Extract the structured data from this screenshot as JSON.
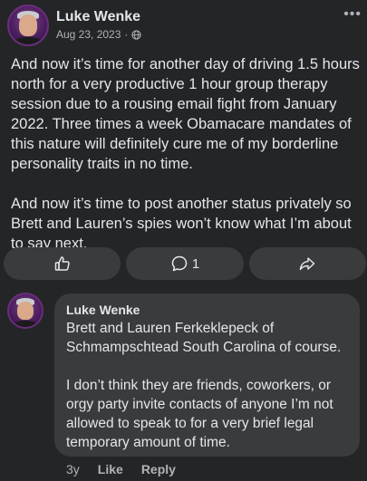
{
  "post": {
    "author": "Luke Wenke",
    "date": "Aug 23, 2023",
    "separator": "·",
    "privacy_icon": "globe-icon",
    "more_label": "•••",
    "paragraphs": [
      "And now it’s time for another day of driving 1.5 hours north for a very productive 1 hour group therapy session due to a rousing email fight from January 2022.  Three times a week Obamacare mandates of this nature will definitely cure me of my borderline personality traits in no time.",
      "And now it’s time to post another status privately so Brett and Lauren’s spies won’t know what I’m about to say next."
    ]
  },
  "actions": {
    "like_icon": "thumbs-up-icon",
    "comment_icon": "comment-icon",
    "comment_count": "1",
    "share_icon": "share-icon"
  },
  "comment": {
    "author": "Luke Wenke",
    "paragraphs": [
      "Brett and Lauren Ferkeklepeck of Schmampschtead South Carolina of course.",
      "I don’t think they are friends, coworkers, or orgy party invite contacts of anyone I’m not allowed to speak to for a very brief legal temporary amount of time."
    ],
    "age": "3y",
    "like_label": "Like",
    "reply_label": "Reply"
  },
  "colors": {
    "background": "#242526",
    "bubble": "#3a3b3c",
    "text": "#e4e6eb",
    "secondary_text": "#b0b3b8"
  }
}
